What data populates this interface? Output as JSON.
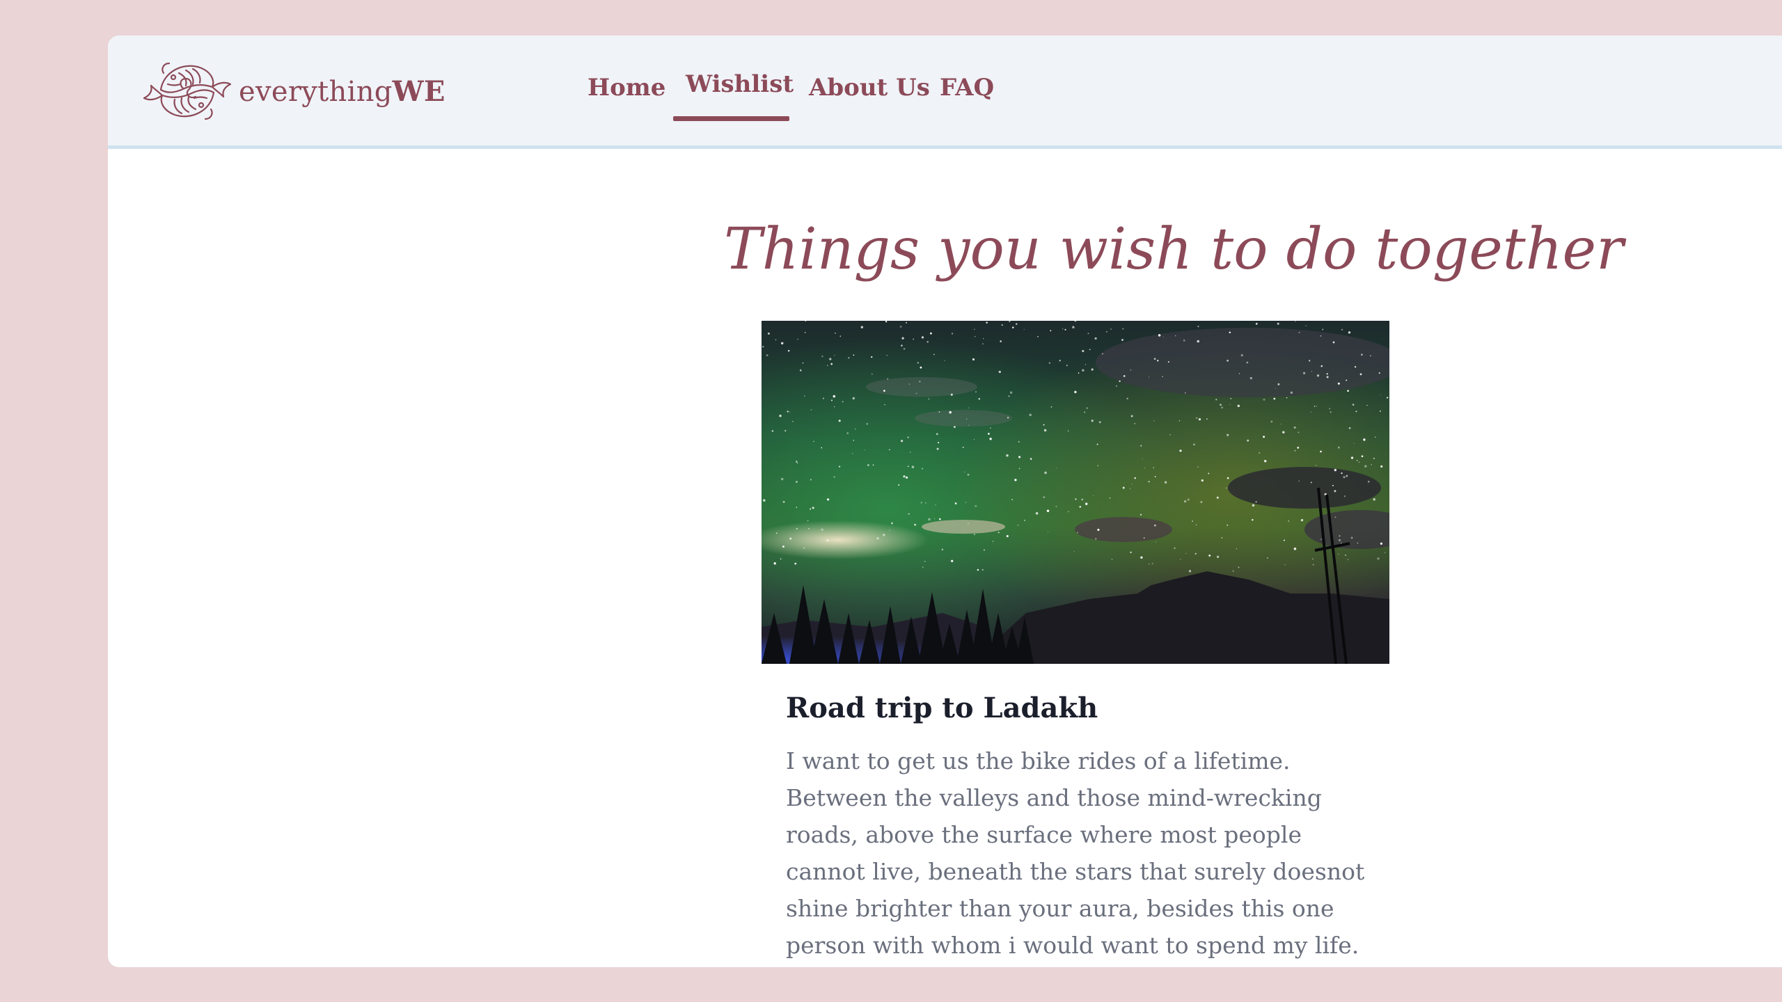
{
  "brand": {
    "name_prefix": "everything",
    "name_bold": "WE",
    "logo_icon": "pisces-fish-icon"
  },
  "nav": {
    "items": [
      {
        "label": "Home",
        "active": false
      },
      {
        "label": "Wishlist",
        "active": true
      },
      {
        "label": "About Us",
        "active": false
      },
      {
        "label": "FAQ",
        "active": false
      }
    ]
  },
  "page": {
    "title": "Things you wish to do together"
  },
  "wish": {
    "title": "Road trip to Ladakh",
    "body": "I want to get us the bike rides of a lifetime. Between the valleys and those mind-wrecking roads, above the surface where most people cannot live, beneath the stars that surely doesnot shine brighter than your aura, besides this one person with whom i would want to spend my life.",
    "heart": "♥",
    "image": "starry-sky-aurora-mountains"
  },
  "colors": {
    "accent": "#8c4a58",
    "background": "#ead4d6",
    "navbar": "#f0f3f8",
    "title_text": "#1b1e2b",
    "body_text": "#6a6f7d"
  }
}
